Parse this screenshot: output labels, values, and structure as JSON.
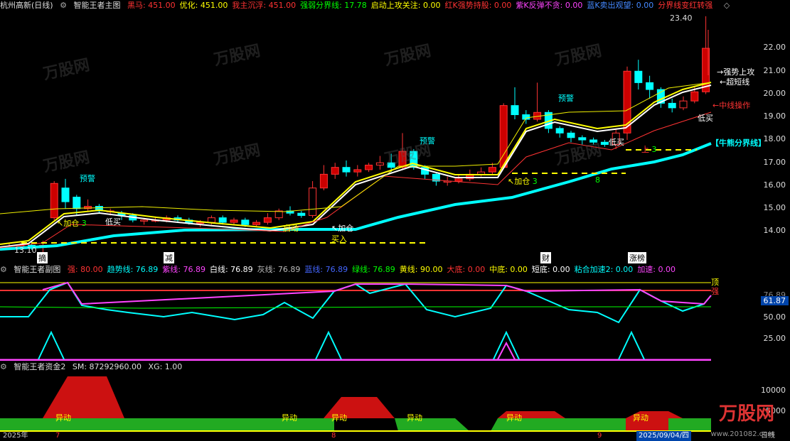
{
  "main_header": {
    "stock": "杭州高新(日线)",
    "indicator": "智能王者主图",
    "items": [
      {
        "label": "黑马: 451.00",
        "color": "#ff3333"
      },
      {
        "label": "优化: 451.00",
        "color": "#ffff00"
      },
      {
        "label": "我主沉浮: 451.00",
        "color": "#ff3333"
      },
      {
        "label": "强弱分界线: 17.78",
        "color": "#00ff00"
      },
      {
        "label": "启动上攻关注: 0.00",
        "color": "#ffff00"
      },
      {
        "label": "红K强势持股: 0.00",
        "color": "#ff3333"
      },
      {
        "label": "紫K反弹不贪: 0.00",
        "color": "#ff44ff"
      },
      {
        "label": "蓝K卖出观望: 0.00",
        "color": "#4488ff"
      },
      {
        "label": "分界线变红转强",
        "color": "#ff3333"
      }
    ]
  },
  "sub_header": {
    "indicator": "智能王者副图",
    "items": [
      {
        "label": "强: 80.00",
        "color": "#ff3333"
      },
      {
        "label": "趋势线: 76.89",
        "color": "#00ffff"
      },
      {
        "label": "紫线: 76.89",
        "color": "#ff44ff"
      },
      {
        "label": "白线: 76.89",
        "color": "#ffffff"
      },
      {
        "label": "灰线: 76.89",
        "color": "#bbbbbb"
      },
      {
        "label": "蓝线: 76.89",
        "color": "#4466ff"
      },
      {
        "label": "绿线: 76.89",
        "color": "#00ff00"
      },
      {
        "label": "黄线: 90.00",
        "color": "#ffff00"
      },
      {
        "label": "大底: 0.00",
        "color": "#ff3333"
      },
      {
        "label": "中底: 0.00",
        "color": "#ffff00"
      },
      {
        "label": "短底: 0.00",
        "color": "#ffffff"
      },
      {
        "label": "粘合加速2: 0.00",
        "color": "#00ffff"
      },
      {
        "label": "加速: 0.00",
        "color": "#ff44ff"
      }
    ]
  },
  "fund_header": {
    "indicator": "智能王者资金2",
    "sm": "SM: 87292960.00",
    "xg": "XG: 1.00"
  },
  "main_axis": [
    "22.00",
    "21.00",
    "20.00",
    "19.00",
    "18.00",
    "17.00",
    "16.00",
    "15.00",
    "14.00"
  ],
  "sub_axis": [
    "76.89",
    "61.87",
    "50.00",
    "25.00"
  ],
  "fund_axis": [
    "10000",
    "5000"
  ],
  "price_labels": {
    "high": "23.40",
    "low": "13.10"
  },
  "annotations": {
    "yujing1": "预警",
    "yujing2": "预警",
    "yujing3": "预警",
    "jiacang1": "加仓",
    "jiacang1_n": "3",
    "jiacang2": "加仓",
    "jiacang3": "加仓",
    "jiacang3_n": "3",
    "num8": "8",
    "dimai1": "低买",
    "dimai2": "低买",
    "dimai3": "低买",
    "qidong": "启动",
    "mairu": "买入",
    "strong_up": "强势上攻",
    "super_short": "超短线",
    "mid_line": "中线操作",
    "niu_line": "【牛熊分界线】",
    "shang": "上",
    "num3": "3"
  },
  "event_tags": [
    "摘",
    "减",
    "财",
    "涨榜"
  ],
  "sub_markers": {
    "ding": "顶",
    "qiang": "强"
  },
  "fund_labels": [
    "异动",
    "异动",
    "异动",
    "异动",
    "异动",
    "异动"
  ],
  "bottom_axis": {
    "year": "2025年",
    "m7": "7",
    "m8": "8",
    "m9": "9",
    "date": "2025/09/04/四",
    "period": "日线"
  },
  "watermark": "万股网",
  "logo": {
    "name": "万股网",
    "url": "www.201082.com"
  }
}
